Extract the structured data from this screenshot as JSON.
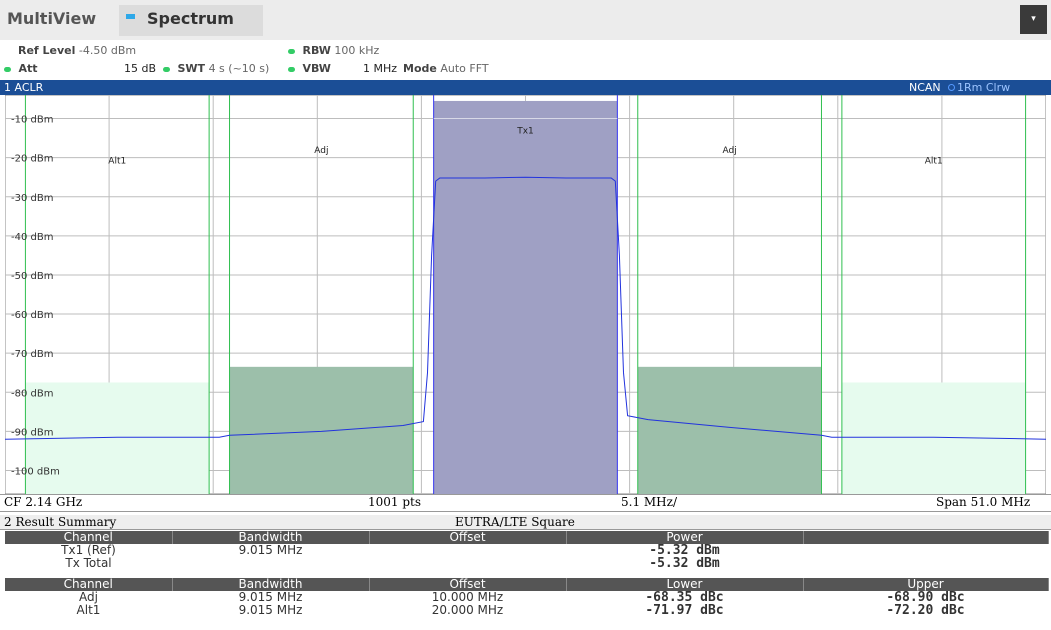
{
  "app": {
    "title": "MultiView",
    "tab_label": "Spectrum",
    "menu_symbol": "▾"
  },
  "settings": {
    "ref_level_label": "Ref Level",
    "ref_level_value": "-4.50 dBm",
    "rbw_label": "RBW",
    "rbw_value": "100 kHz",
    "att_label": "Att",
    "att_value": "15 dB",
    "swt_label": "SWT",
    "swt_value": "4 s (~10 s)",
    "vbw_label": "VBW",
    "vbw_value": "1 MHz",
    "mode_label": "Mode",
    "mode_value": "Auto FFT"
  },
  "window1": {
    "title": "1 ACLR",
    "right_label": "NCAN",
    "trace_label": "1Rm Clrw",
    "footer_left": "CF 2.14 GHz",
    "footer_pts": "1001 pts",
    "footer_div": "5.1 MHz/",
    "footer_span": "Span 51.0 MHz"
  },
  "chart_data": {
    "type": "line",
    "y_unit": "dBm",
    "ylim": [
      -105,
      -5
    ],
    "y_ticks": [
      -10,
      -20,
      -30,
      -40,
      -50,
      -60,
      -70,
      -80,
      -90,
      -100
    ],
    "y_tick_labels": [
      "-10 dBm",
      "-20 dBm",
      "-30 dBm",
      "-40 dBm",
      "-50 dBm",
      "-60 dBm",
      "-70 dBm",
      "-80 dBm",
      "-90 dBm",
      "-100 dBm"
    ],
    "x_unit": "MHz offset from CF",
    "xlim": [
      -25.5,
      25.5
    ],
    "grid": true,
    "channels": [
      {
        "name": "Alt1",
        "from": -24.5,
        "to": -15.5,
        "limit": -77.5,
        "color": "#e6fbee"
      },
      {
        "name": "Adj",
        "from": -14.5,
        "to": -5.5,
        "limit": -73.5,
        "color": "#9cbfaa"
      },
      {
        "name": "Tx1",
        "from": -4.5,
        "to": 4.5,
        "limit": -5.5,
        "color": "#9fa0c4"
      },
      {
        "name": "Adj",
        "from": 5.5,
        "to": 14.5,
        "limit": -73.5,
        "color": "#9cbfaa"
      },
      {
        "name": "Alt1",
        "from": 15.5,
        "to": 24.5,
        "limit": -77.5,
        "color": "#e6fbee"
      }
    ],
    "trace": {
      "color": "#2233dd",
      "x": [
        -25.5,
        -20,
        -15,
        -14.5,
        -10,
        -6,
        -5,
        -4.8,
        -4.6,
        -4.4,
        -4.2,
        -2,
        0,
        2,
        4.2,
        4.4,
        4.6,
        4.8,
        5,
        6,
        10,
        14.5,
        15,
        20,
        25.5
      ],
      "y": [
        -92,
        -91.5,
        -91.5,
        -91,
        -90,
        -88.5,
        -87.5,
        -75,
        -45,
        -26,
        -25.2,
        -25.2,
        -25,
        -25.2,
        -25.2,
        -26,
        -45,
        -75,
        -86,
        -87,
        -89,
        -91,
        -91.5,
        -91.5,
        -92
      ]
    }
  },
  "window2": {
    "title": "2 Result Summary",
    "standard": "EUTRA/LTE Square"
  },
  "results": {
    "head1": [
      "Channel",
      "Bandwidth",
      "Offset",
      "Power",
      ""
    ],
    "tx_rows": [
      [
        "Tx1 (Ref)",
        "9.015 MHz",
        "",
        "-5.32 dBm",
        ""
      ],
      [
        "Tx Total",
        "",
        "",
        "-5.32 dBm",
        ""
      ]
    ],
    "head2": [
      "Channel",
      "Bandwidth",
      "Offset",
      "Lower",
      "Upper"
    ],
    "adj_rows": [
      [
        "Adj",
        "9.015 MHz",
        "10.000 MHz",
        "-68.35 dBc",
        "-68.90 dBc"
      ],
      [
        "Alt1",
        "9.015 MHz",
        "20.000 MHz",
        "-71.97 dBc",
        "-72.20 dBc"
      ]
    ]
  }
}
